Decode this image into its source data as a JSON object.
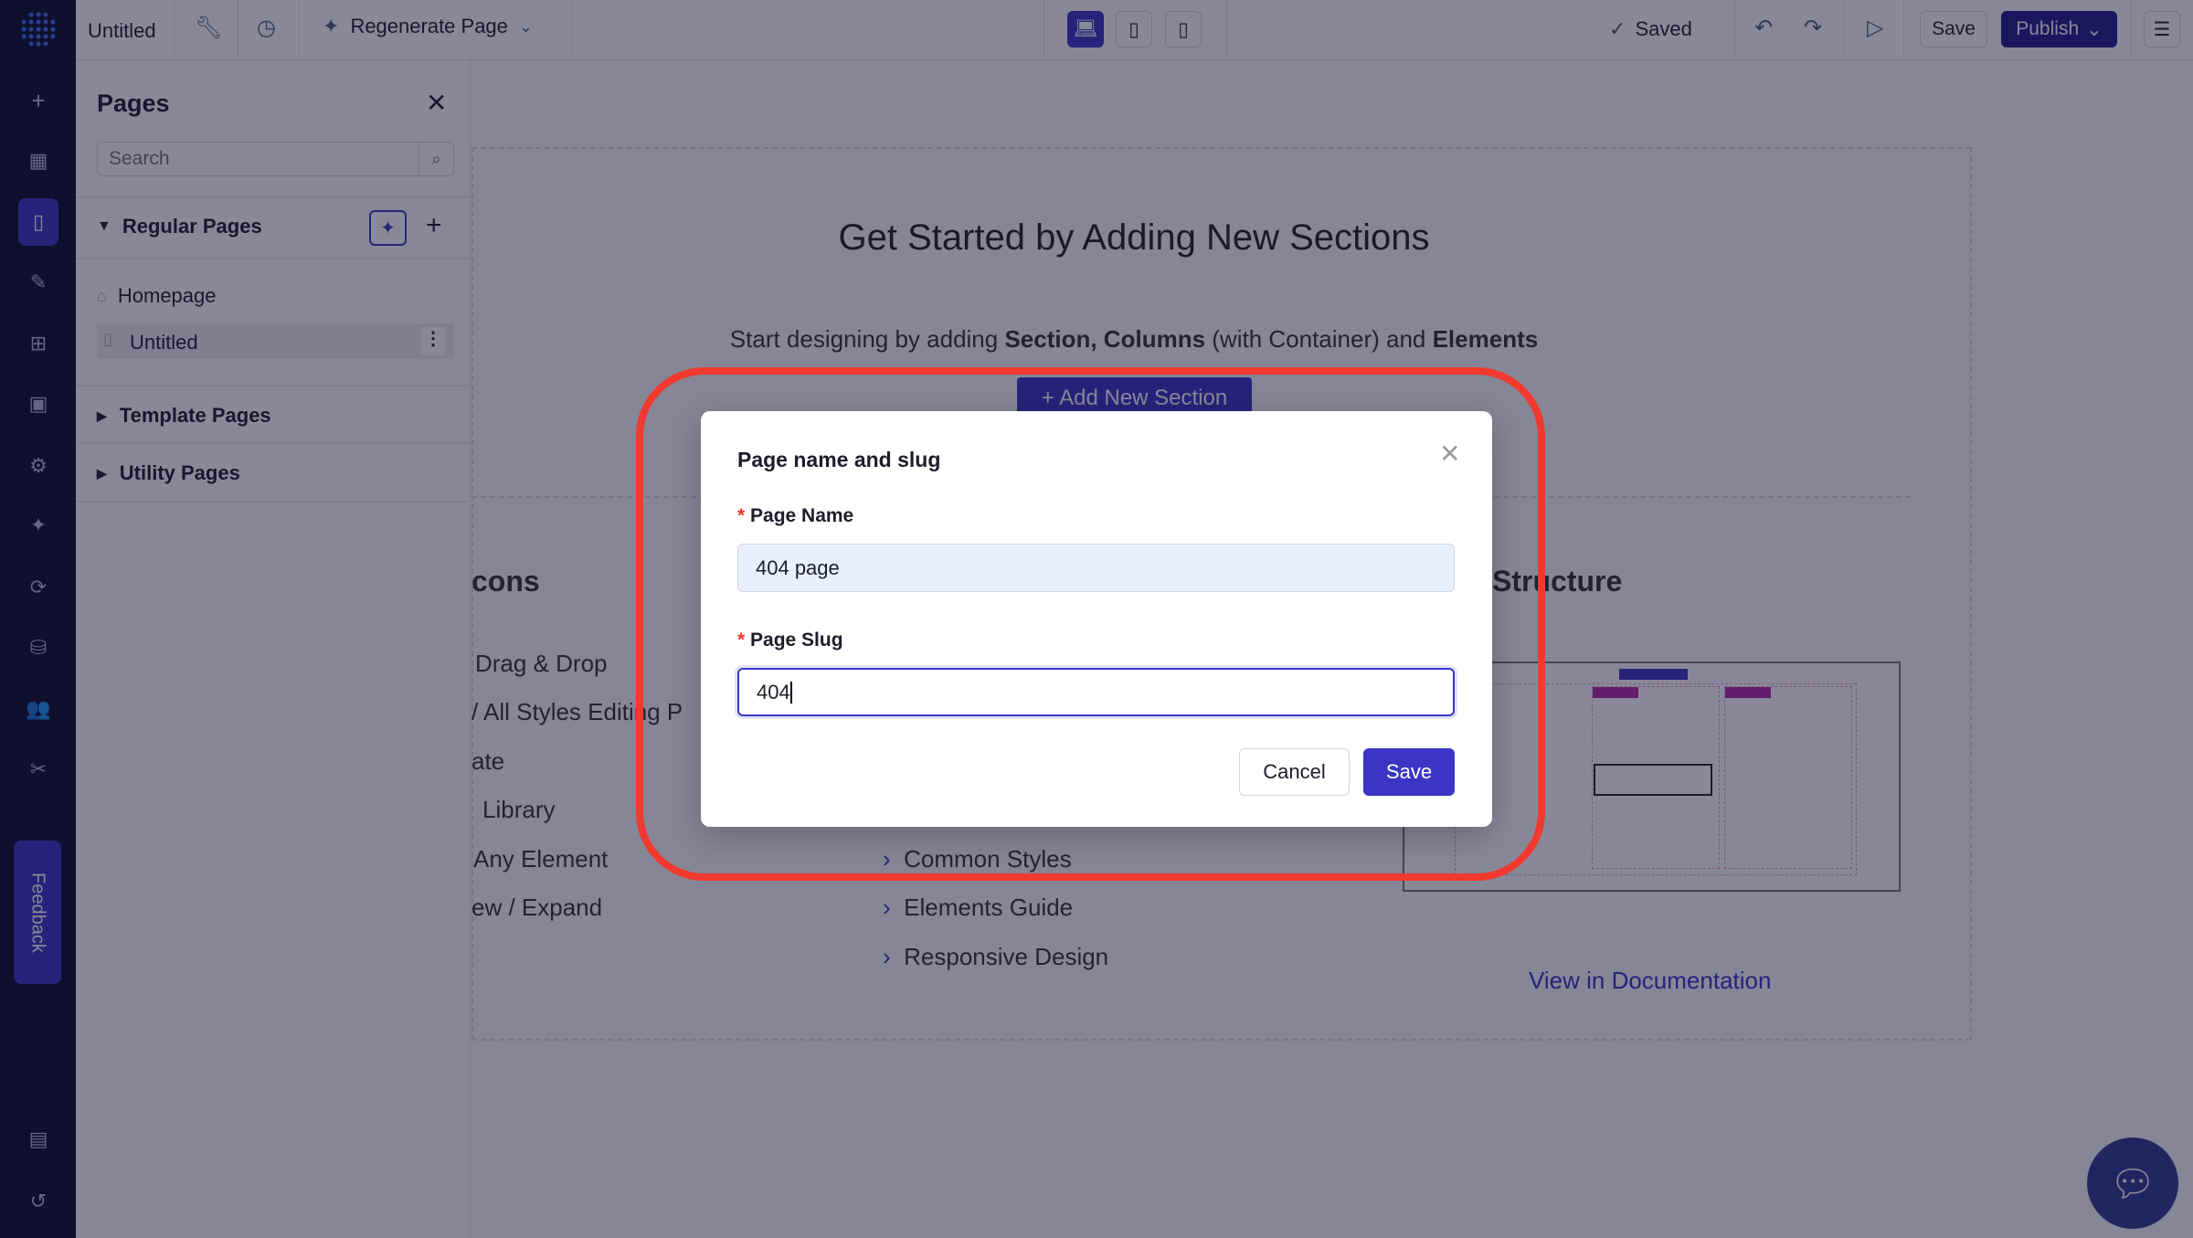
{
  "topbar": {
    "page_title": "Untitled",
    "regenerate_label": "Regenerate Page",
    "saved_label": "Saved",
    "save_label": "Save",
    "publish_label": "Publish"
  },
  "rail": {
    "feedback_label": "Feedback"
  },
  "pages_panel": {
    "title": "Pages",
    "search_placeholder": "Search",
    "groups": [
      {
        "label": "Regular Pages",
        "expanded": true,
        "items": [
          {
            "label": "Homepage",
            "icon": "home-icon"
          },
          {
            "label": "Untitled",
            "icon": "file-icon",
            "selected": true
          }
        ]
      },
      {
        "label": "Template Pages",
        "expanded": false
      },
      {
        "label": "Utility Pages",
        "expanded": false
      }
    ]
  },
  "canvas": {
    "title": "Get Started by Adding New Sections",
    "subtitle_pre": "Start designing by adding ",
    "subtitle_bold1": "Section, Columns",
    "subtitle_mid": " (with Container) and ",
    "subtitle_bold2": "Elements",
    "add_section_label": "+ Add New Section",
    "left_heading": "cons",
    "left_items": [
      "Drag & Drop",
      "/ All Styles Editing P",
      "ate",
      "Library",
      "Any Element",
      "ew / Expand"
    ],
    "middle_items": [
      "Common Styles",
      "Elements Guide",
      "Responsive Design"
    ],
    "right_heading": "Structure",
    "doc_link": "View in Documentation"
  },
  "modal": {
    "title": "Page name and slug",
    "name_label": "Page Name",
    "name_value": "404 page",
    "slug_label": "Page Slug",
    "slug_value": "404",
    "cancel_label": "Cancel",
    "save_label": "Save"
  },
  "colors": {
    "accent": "#3a35c5",
    "highlight": "#f2392f",
    "rail": "#0b0d2a"
  }
}
